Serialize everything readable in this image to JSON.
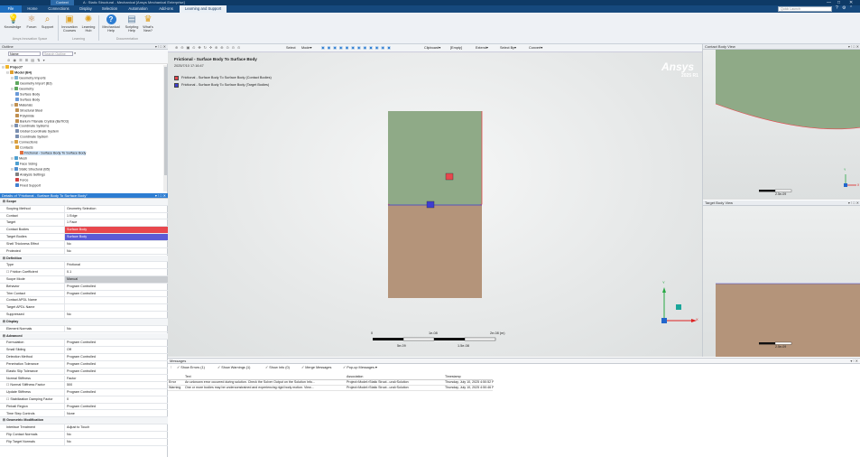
{
  "window": {
    "context_tab": "Context",
    "title": "A : Static Structural - Mechanical [Ansys Mechanical Enterprise]",
    "controls": [
      "—",
      "□",
      "✕"
    ]
  },
  "tabs": [
    {
      "label": "File"
    },
    {
      "label": "Home"
    },
    {
      "label": "Connections"
    },
    {
      "label": "Display"
    },
    {
      "label": "Selection"
    },
    {
      "label": "Automation"
    },
    {
      "label": "Add-ons"
    },
    {
      "label": "Learning and Support"
    }
  ],
  "quick_launch": {
    "placeholder": "Quick Launch"
  },
  "ribbon": {
    "buttons": [
      {
        "label": "Knowledge",
        "icon": "lightbulb-icon",
        "glyph": "💡"
      },
      {
        "label": "Forum",
        "icon": "share-icon",
        "glyph": "⚛"
      },
      {
        "label": "Support",
        "icon": "support-icon",
        "glyph": "⌕"
      },
      {
        "label": "Innovation Courses",
        "icon": "courses-icon",
        "glyph": "▣"
      },
      {
        "label": "Learning Hub",
        "icon": "learning-hub-icon",
        "glyph": "✺"
      },
      {
        "label": "Mechanical Help",
        "icon": "help-icon",
        "glyph": "?"
      },
      {
        "label": "Scripting Help",
        "icon": "scripting-help-icon",
        "glyph": "▤"
      },
      {
        "label": "What's New?",
        "icon": "whats-new-icon",
        "glyph": "♛"
      }
    ],
    "groups": [
      "Ansys Innovation Space",
      "Learning",
      "Documentation"
    ]
  },
  "outline": {
    "title": "Outline",
    "name_field": "Name",
    "search_placeholder": "Search Outline",
    "tree": [
      {
        "label": "Project*",
        "depth": 0,
        "color": "#f0b429"
      },
      {
        "label": "Model (B4)",
        "depth": 1,
        "color": "#e0a030"
      },
      {
        "label": "Geometry Imports",
        "depth": 2,
        "color": "#7fb3d5"
      },
      {
        "label": "Geometry Import (B3)",
        "depth": 3,
        "color": "#5fa85f"
      },
      {
        "label": "Geometry",
        "depth": 2,
        "color": "#5fa85f"
      },
      {
        "label": "Surface Body",
        "depth": 3,
        "color": "#6a9ad8"
      },
      {
        "label": "Surface Body",
        "depth": 3,
        "color": "#6a9ad8"
      },
      {
        "label": "Materials",
        "depth": 2,
        "color": "#c09050"
      },
      {
        "label": "Structural Steel",
        "depth": 3,
        "color": "#c09050"
      },
      {
        "label": "Polyimide",
        "depth": 3,
        "color": "#c09050"
      },
      {
        "label": "Barium Titanate Crystal (BaTiO3)",
        "depth": 3,
        "color": "#c09050"
      },
      {
        "label": "Coordinate Systems",
        "depth": 2,
        "color": "#7a8fb0"
      },
      {
        "label": "Global Coordinate System",
        "depth": 3,
        "color": "#7a8fb0"
      },
      {
        "label": "Coordinate System",
        "depth": 3,
        "color": "#7a8fb0"
      },
      {
        "label": "Connections",
        "depth": 2,
        "color": "#d9a040"
      },
      {
        "label": "Contacts",
        "depth": 3,
        "color": "#d9a040"
      },
      {
        "label": "Frictional - Surface Body To Surface Body",
        "depth": 4,
        "color": "#e07040",
        "selected": true
      },
      {
        "label": "Mesh",
        "depth": 2,
        "color": "#4fa0d0"
      },
      {
        "label": "Face Sizing",
        "depth": 3,
        "color": "#4fa0d0"
      },
      {
        "label": "Static Structural (B5)",
        "depth": 2,
        "color": "#4f8fd0"
      },
      {
        "label": "Analysis Settings",
        "depth": 3,
        "color": "#808080"
      },
      {
        "label": "Force",
        "depth": 3,
        "color": "#d04040"
      },
      {
        "label": "Fixed Support",
        "depth": 3,
        "color": "#4080d0"
      }
    ]
  },
  "details": {
    "title": "Details of \"Frictional - Surface Body To Surface Body\"",
    "rows": [
      {
        "section": true,
        "key": "Scope"
      },
      {
        "key": "Scoping Method",
        "value": "Geometry Selection"
      },
      {
        "key": "Contact",
        "value": "1 Edge"
      },
      {
        "key": "Target",
        "value": "1 Face"
      },
      {
        "key": "Contact Bodies",
        "value": "Surface Body",
        "color": "#e8474d"
      },
      {
        "key": "Target Bodies",
        "value": "Surface Body",
        "color": "#5b5bd6"
      },
      {
        "key": "Shell Thickness Effect",
        "value": "No"
      },
      {
        "key": "Protected",
        "value": "No"
      },
      {
        "section": true,
        "key": "Definition"
      },
      {
        "key": "Type",
        "value": "Frictional"
      },
      {
        "key": "Friction Coefficient",
        "value": "0.1",
        "check": true
      },
      {
        "key": "Scope Mode",
        "value": "Manual",
        "color": "#c9ccd0"
      },
      {
        "key": "Behavior",
        "value": "Program Controlled"
      },
      {
        "key": "Trim Contact",
        "value": "Program Controlled"
      },
      {
        "key": "Contact APDL Name",
        "value": ""
      },
      {
        "key": "Target APDL Name",
        "value": ""
      },
      {
        "key": "Suppressed",
        "value": "No"
      },
      {
        "section": true,
        "key": "Display"
      },
      {
        "key": "Element Normals",
        "value": "No"
      },
      {
        "section": true,
        "key": "Advanced"
      },
      {
        "key": "Formulation",
        "value": "Program Controlled"
      },
      {
        "key": "Small Sliding",
        "value": "Off"
      },
      {
        "key": "Detection Method",
        "value": "Program Controlled"
      },
      {
        "key": "Penetration Tolerance",
        "value": "Program Controlled"
      },
      {
        "key": "Elastic Slip Tolerance",
        "value": "Program Controlled"
      },
      {
        "key": "Normal Stiffness",
        "value": "Factor"
      },
      {
        "key": "Normal Stiffness Factor",
        "value": "500",
        "check": true
      },
      {
        "key": "Update Stiffness",
        "value": "Program Controlled"
      },
      {
        "key": "Stabilization Damping Factor",
        "value": "0",
        "check": true
      },
      {
        "key": "Pinball Region",
        "value": "Program Controlled"
      },
      {
        "key": "Time Step Controls",
        "value": "None"
      },
      {
        "section": true,
        "key": "Geometric Modification"
      },
      {
        "key": "Interface Treatment",
        "value": "Adjust to Touch"
      },
      {
        "key": "Flip Contact Normals",
        "value": "No"
      },
      {
        "key": "Flip Target Normals",
        "value": "No"
      }
    ]
  },
  "graphics": {
    "toolbar": [
      "Select",
      "Mode▾",
      "Clipboard▾",
      "[Empty]",
      "Extend▾",
      "Select By▾",
      "Convert▾"
    ],
    "title": "Frictional - Surface Body To Surface Body",
    "date": "2025/7/10 17:16:47",
    "legend": [
      {
        "label": "Frictional - Surface Body To Surface Body (Contact Bodies)",
        "color": "#e8474d"
      },
      {
        "label": "Frictional - Surface Body To Surface Body (Target Bodies)",
        "color": "#3d3dd1"
      }
    ],
    "brand": "Ansys",
    "release": "2025 R1",
    "scale_top": [
      "0",
      "1e-08",
      "2e-08 (m)"
    ],
    "scale_bottom": [
      "5e-09",
      "1.5e-08"
    ],
    "axes": {
      "x": "X",
      "y": "Y"
    },
    "colors": {
      "green_body": "#8faa87",
      "tan_body": "#b4947a",
      "contact": "#e8474d",
      "target": "#3d3dd1"
    }
  },
  "contact_view": {
    "title": "Contact Body View",
    "scale": "2.5e-09",
    "axes": {
      "x": "X",
      "y": "Y"
    }
  },
  "target_view": {
    "title": "Target Body View",
    "scale": "2.5e-09"
  },
  "messages": {
    "title": "Messages",
    "filters": [
      "Show Errors (1)",
      "Show Warnings (1)",
      "Show Info (0)",
      "Merge Messages",
      "Pop-up Messages ▾"
    ],
    "columns": [
      "",
      "Text",
      "Association",
      "Timestamp"
    ],
    "rows": [
      {
        "type": "Error",
        "text": "An unknown error occurred during solution. Check the Solver Output on the Solution Info...",
        "assoc": "Project>Model>Static Struct...ural>Solution",
        "time": "Thursday, July 10, 2025 4:50:52 PM"
      },
      {
        "type": "Warning",
        "text": "One or more bodies may be underconstrained and experiencing rigid body motion. View...",
        "assoc": "Project>Model>Static Struct...ural>Solution",
        "time": "Thursday, July 10, 2025 4:50:46 PM"
      }
    ]
  }
}
